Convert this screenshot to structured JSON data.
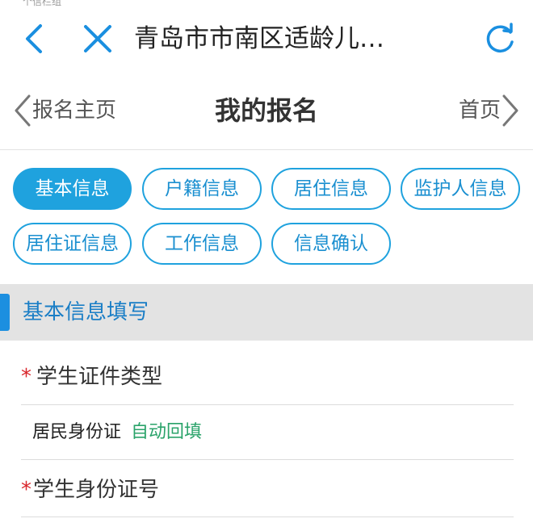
{
  "status_bar": {
    "text": "个信栏组"
  },
  "browser": {
    "title": "青岛市市南区适龄儿…",
    "icons": {
      "back": "chevron-left-icon",
      "close": "close-icon",
      "refresh": "refresh-icon"
    }
  },
  "nav": {
    "back_label": "报名主页",
    "title": "我的报名",
    "home_label": "首页"
  },
  "tabs": [
    {
      "label": "基本信息",
      "active": true
    },
    {
      "label": "户籍信息",
      "active": false
    },
    {
      "label": "居住信息",
      "active": false
    },
    {
      "label": "监护人信息",
      "active": false
    },
    {
      "label": "居住证信息",
      "active": false
    },
    {
      "label": "工作信息",
      "active": false
    },
    {
      "label": "信息确认",
      "active": false
    }
  ],
  "section": {
    "title": "基本信息填写"
  },
  "form": {
    "id_type": {
      "required_mark": "*",
      "label": "学生证件类型",
      "value": "居民身份证",
      "hint": "自动回填"
    },
    "id_number": {
      "required_mark": "*",
      "label": "学生身份证号"
    }
  },
  "colors": {
    "accent": "#1fa2de",
    "section_bar": "#1c8fe0",
    "required": "#d9262b",
    "auto_fill": "#2aa36a"
  }
}
